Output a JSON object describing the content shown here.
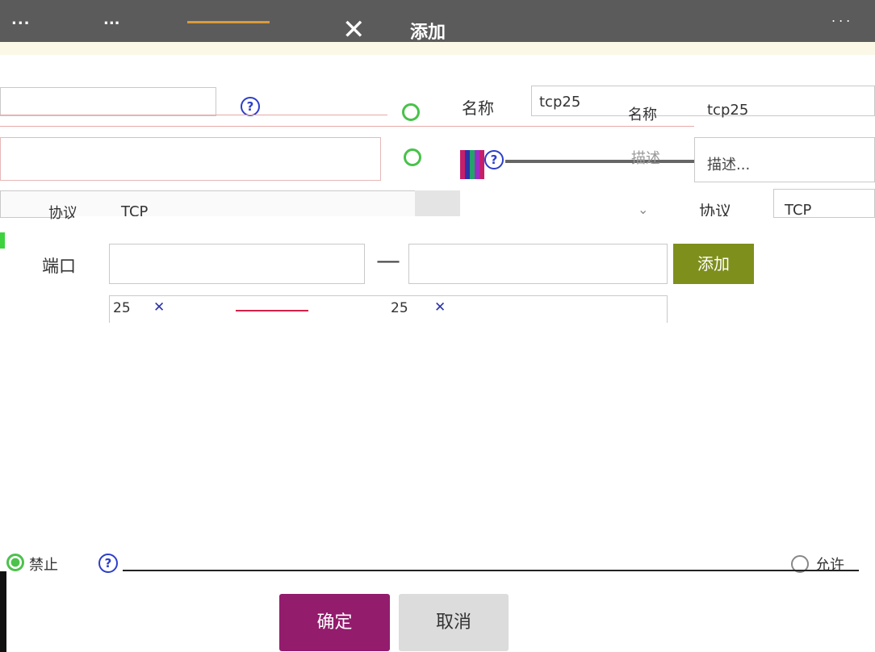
{
  "topbar": {
    "tab_a": "...",
    "tab_b": "...",
    "close_icon": "close-icon",
    "dialog_title": "添加",
    "right_indicator": "..."
  },
  "form": {
    "name_label": "名称",
    "name_value": "tcp25",
    "name_label_ghost": "名称",
    "name_value_ghost": "tcp25",
    "desc_label": "描述",
    "desc_placeholder": "描述...",
    "protocol_label": "协议",
    "protocol_value": "TCP",
    "protocol_label_ghost": "协议",
    "protocol_value_ghost": "TCP",
    "port_label": "端口",
    "port_separator": "—",
    "add_button": "添加",
    "tags": [
      {
        "value": "25"
      },
      {
        "value": "25"
      }
    ],
    "radio_group_label": "禁止",
    "radio_options": [
      {
        "label": "允许",
        "selected": false
      }
    ],
    "confirm_button": "确定",
    "cancel_button": "取消"
  },
  "colors": {
    "topbar": "#5b5b5b",
    "add_button": "#7f8f1c",
    "confirm_button": "#931c6d",
    "cancel_button": "#dcdcdc",
    "help_icon": "#2c3ec9",
    "radio_active": "#4cc24c"
  }
}
